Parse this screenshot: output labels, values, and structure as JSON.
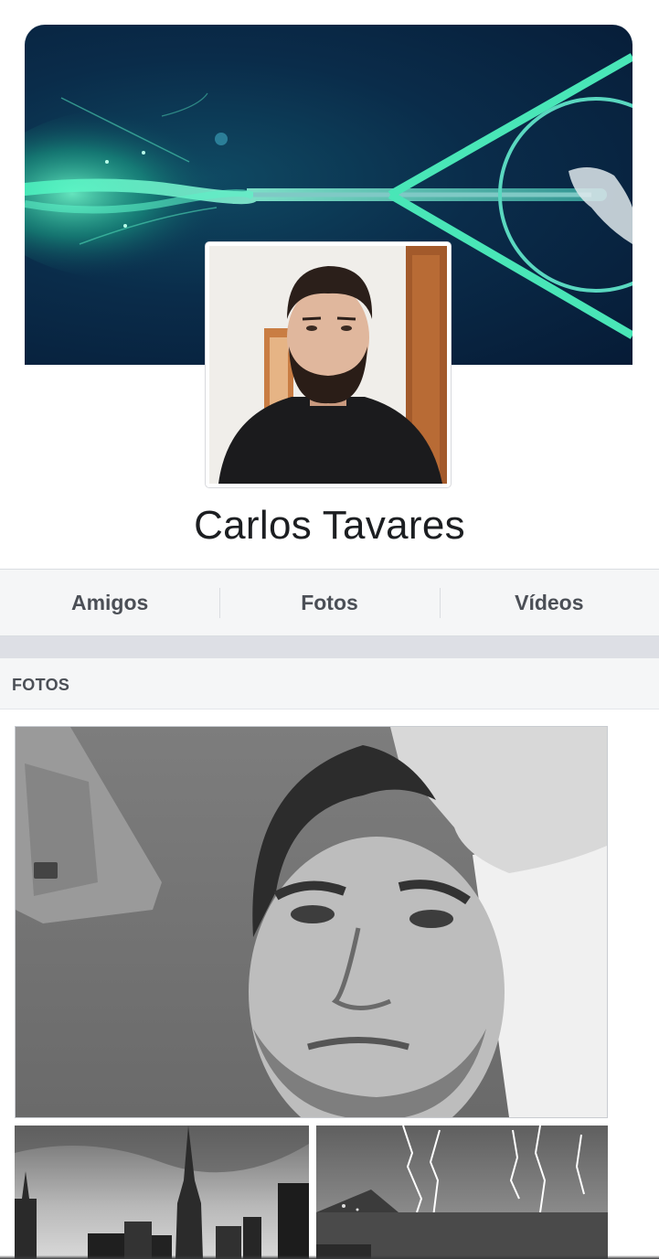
{
  "profile": {
    "name": "Carlos Tavares"
  },
  "tabs": [
    {
      "label": "Amigos"
    },
    {
      "label": "Fotos"
    },
    {
      "label": "Vídeos"
    }
  ],
  "photos_section": {
    "title": "FOTOS"
  },
  "colors": {
    "tab_background": "#f5f6f7",
    "separator": "#dddfe5",
    "text_primary": "#1c1e21",
    "text_secondary": "#4b4f56",
    "cover_glow": "#3fe3b0"
  }
}
